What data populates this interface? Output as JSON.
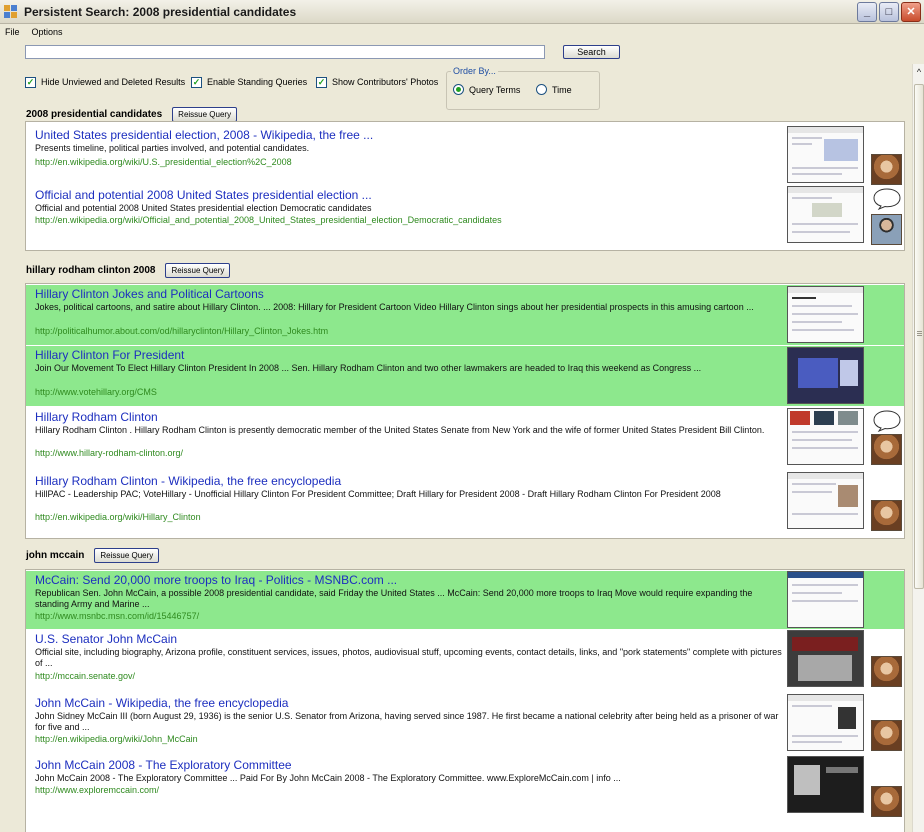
{
  "window": {
    "title": "Persistent Search: 2008 presidential candidates",
    "minimize": "_",
    "maximize": "□",
    "close": "✕"
  },
  "menu": [
    "File",
    "Options"
  ],
  "search": {
    "value": "",
    "button": "Search"
  },
  "options": {
    "hide_unviewed": {
      "label": "Hide Unviewed and Deleted Results",
      "checked": true
    },
    "standing_queries": {
      "label": "Enable Standing Queries",
      "checked": true
    },
    "contributors_photos": {
      "label": "Show Contributors' Photos",
      "checked": true
    }
  },
  "order_by": {
    "legend": "Order By...",
    "options": [
      {
        "label": "Query Terms",
        "selected": true
      },
      {
        "label": "Time",
        "selected": false
      }
    ]
  },
  "reissue_label": "Reissue Query",
  "groups": [
    {
      "query": "2008 presidential candidates",
      "results": [
        {
          "title": "United States presidential election, 2008 - Wikipedia, the free ...",
          "snippet": "Presents timeline, political parties involved, and potential candidates.",
          "url": "http://en.wikipedia.org/wiki/U.S._presidential_election%2C_2008",
          "viewed": false
        },
        {
          "title": "Official and potential 2008 United States presidential election ...",
          "snippet": "Official and potential 2008 United States presidential election Democratic candidates",
          "url": "http://en.wikipedia.org/wiki/Official_and_potential_2008_United_States_presidential_election_Democratic_candidates",
          "viewed": false
        }
      ]
    },
    {
      "query": "hillary rodham clinton 2008",
      "results": [
        {
          "title": "Hillary Clinton Jokes and Political Cartoons",
          "snippet": "Jokes, political cartoons, and satire about Hillary Clinton. ... 2008: Hillary for President Cartoon Video Hillary Clinton sings about her presidential prospects in this amusing cartoon ...",
          "url": "http://politicalhumor.about.com/od/hillaryclinton/Hillary_Clinton_Jokes.htm",
          "viewed": true
        },
        {
          "title": "Hillary Clinton For President",
          "snippet": "Join Our Movement To Elect Hillary Clinton President In 2008 ... Sen. Hillary Rodham Clinton and two other lawmakers are headed to Iraq this weekend as Congress ...",
          "url": "http://www.votehillary.org/CMS",
          "viewed": true
        },
        {
          "title": "Hillary Rodham Clinton",
          "snippet": "Hillary Rodham Clinton . Hillary Rodham Clinton is presently democratic member of the United States Senate from New York and the wife of former United States President Bill Clinton.",
          "url": "http://www.hillary-rodham-clinton.org/",
          "viewed": false
        },
        {
          "title": "Hillary Rodham Clinton - Wikipedia, the free encyclopedia",
          "snippet": "HillPAC - Leadership PAC; VoteHillary - Unofficial Hillary Clinton For President Committee; Draft Hillary for President 2008 - Draft Hillary Rodham Clinton For President 2008",
          "url": "http://en.wikipedia.org/wiki/Hillary_Clinton",
          "viewed": false
        }
      ]
    },
    {
      "query": "john mccain",
      "results": [
        {
          "title": "McCain: Send 20,000 more troops to Iraq - Politics - MSNBC.com ...",
          "snippet": "Republican Sen. John McCain, a possible 2008 presidential candidate, said Friday the United States ... McCain: Send 20,000 more troops to Iraq Move would require expanding the standing Army and Marine ...",
          "url": "http://www.msnbc.msn.com/id/15446757/",
          "viewed": true
        },
        {
          "title": "U.S. Senator John McCain",
          "snippet": "Official site, including biography, Arizona profile, constituent services, issues, photos, audiovisual stuff, upcoming events, contact details, links, and \"pork statements\" complete with pictures of ...",
          "url": "http://mccain.senate.gov/",
          "viewed": false
        },
        {
          "title": "John McCain - Wikipedia, the free encyclopedia",
          "snippet": "John Sidney McCain III (born August 29, 1936) is the senior U.S. Senator from Arizona, having served since 1987. He first became a national celebrity after being held as a prisoner of war for five and ...",
          "url": "http://en.wikipedia.org/wiki/John_McCain",
          "viewed": false
        },
        {
          "title": "John McCain 2008 - The Exploratory Committee",
          "snippet": "John McCain 2008 - The Exploratory Committee ... Paid For By John McCain 2008 - The Exploratory Committee. www.ExploreMcCain.com | info ...",
          "url": "http://www.exploremccain.com/",
          "viewed": false
        }
      ]
    }
  ]
}
